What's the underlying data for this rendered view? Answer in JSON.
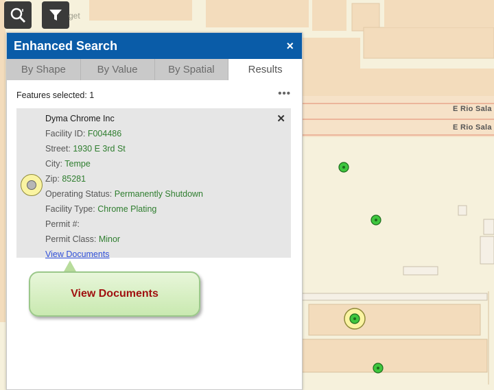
{
  "toolbar": {
    "ghost_text": "get"
  },
  "map": {
    "road_label_1": "E Rio Sala",
    "road_label_2": "E Rio Sala",
    "colors": {
      "background": "#f6f1dc",
      "building": "#f3dcbc",
      "road": "#f0c9ae",
      "feature_dot": "#3ec63e"
    }
  },
  "panel": {
    "title": "Enhanced Search",
    "close_label": "×",
    "tabs": [
      {
        "label": "By Shape",
        "active": false
      },
      {
        "label": "By Value",
        "active": false
      },
      {
        "label": "By Spatial",
        "active": false
      },
      {
        "label": "Results",
        "active": true
      }
    ],
    "features_selected_label": "Features selected: 1",
    "more_label": "•••",
    "result": {
      "name": "Dyma Chrome Inc",
      "facility_id_label": "Facility ID:",
      "facility_id": "F004486",
      "street_label": "Street:",
      "street": "1930 E 3rd St",
      "city_label": "City:",
      "city": "Tempe",
      "zip_label": "Zip:",
      "zip": "85281",
      "status_label": "Operating Status:",
      "status": "Permanently Shutdown",
      "type_label": "Facility Type:",
      "type": "Chrome Plating",
      "permit_label": "Permit #:",
      "permit": "",
      "permit_class_label": "Permit Class:",
      "permit_class": "Minor",
      "link_label": "View Documents",
      "close_label": "✕"
    }
  },
  "callout": {
    "text": "View Documents"
  }
}
